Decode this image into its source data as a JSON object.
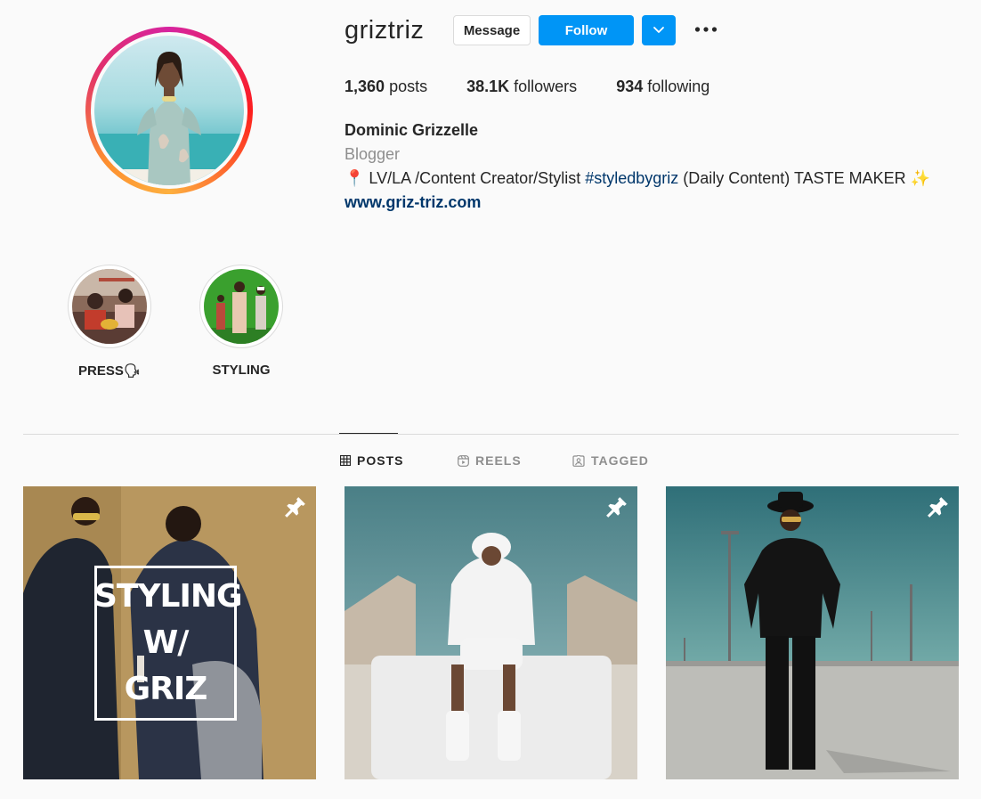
{
  "profile": {
    "username": "griztriz",
    "posts_count": "1,360",
    "posts_label": "posts",
    "followers_count": "38.1K",
    "followers_label": "followers",
    "following_count": "934",
    "following_label": "following",
    "full_name": "Dominic Grizzelle",
    "category": "Blogger",
    "bio_prefix": "📍 LV/LA /Content Creator/Stylist ",
    "bio_hashtag": "#styledbygriz",
    "bio_suffix": " (Daily Content) TASTE MAKER ✨",
    "website": "www.griz-triz.com"
  },
  "actions": {
    "message_label": "Message",
    "follow_label": "Follow"
  },
  "highlights": [
    {
      "label": "PRESS🗣"
    },
    {
      "label": "STYLING"
    }
  ],
  "tabs": [
    {
      "label": "POSTS",
      "icon": "grid-icon",
      "active": true
    },
    {
      "label": "REELS",
      "icon": "reels-icon",
      "active": false
    },
    {
      "label": "TAGGED",
      "icon": "tagged-icon",
      "active": false
    }
  ],
  "posts": [
    {
      "overlay_lines": [
        "STYLING",
        "W/",
        "GRIZ"
      ],
      "pinned": true
    },
    {
      "pinned": true
    },
    {
      "pinned": true
    }
  ],
  "colors": {
    "accent": "#0095f6",
    "link": "#00376b",
    "secondary_text": "#8e8e8e",
    "border": "#dbdbdb"
  }
}
